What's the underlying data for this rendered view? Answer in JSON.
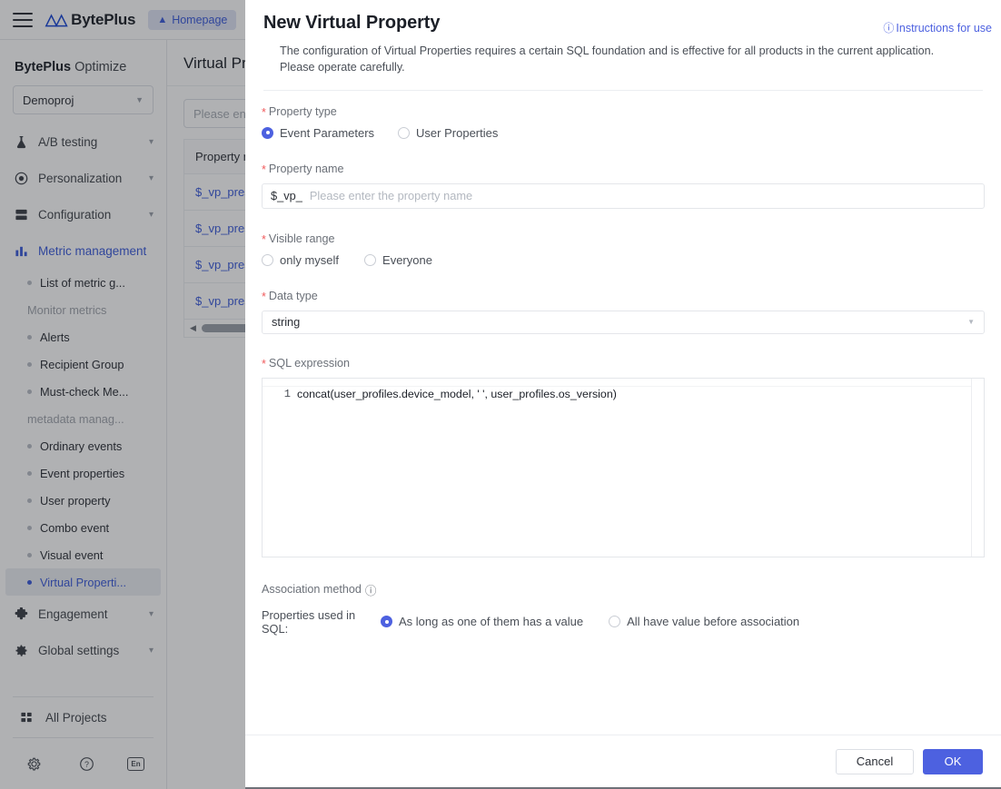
{
  "topbar": {
    "menu_icon": "hamburger-icon",
    "brand_mark": "M",
    "brand_name": "BytePlus",
    "homepage_label": "Homepage",
    "home_icon": "home-icon"
  },
  "sidebar": {
    "title_bold": "BytePlus",
    "title_rest": " Optimize",
    "project": {
      "value": "Demoproj",
      "caret_icon": "chevron-down-icon"
    },
    "groups": [
      {
        "label": "A/B testing",
        "icon": "flask-icon",
        "chevron": "chevron-down-icon",
        "active": false
      },
      {
        "label": "Personalization",
        "icon": "target-icon",
        "chevron": "chevron-down-icon",
        "active": false
      },
      {
        "label": "Configuration",
        "icon": "server-icon",
        "chevron": "chevron-down-icon",
        "active": false
      },
      {
        "label": "Metric management",
        "icon": "bar-chart-icon",
        "chevron": "",
        "active": true
      }
    ],
    "metric_children": [
      {
        "type": "item",
        "label": "List of metric g...",
        "selected": false
      },
      {
        "type": "head",
        "label": "Monitor metrics"
      },
      {
        "type": "item",
        "label": "Alerts",
        "selected": false
      },
      {
        "type": "item",
        "label": "Recipient Group",
        "selected": false
      },
      {
        "type": "item",
        "label": "Must-check Me...",
        "selected": false
      },
      {
        "type": "head",
        "label": "metadata manag..."
      },
      {
        "type": "item",
        "label": "Ordinary events",
        "selected": false
      },
      {
        "type": "item",
        "label": "Event properties",
        "selected": false
      },
      {
        "type": "item",
        "label": "User property",
        "selected": false
      },
      {
        "type": "item",
        "label": "Combo event",
        "selected": false
      },
      {
        "type": "item",
        "label": "Visual event",
        "selected": false
      },
      {
        "type": "item",
        "label": "Virtual Properti...",
        "selected": true
      }
    ],
    "groups_after": [
      {
        "label": "Engagement",
        "icon": "puzzle-icon",
        "chevron": "chevron-down-icon"
      },
      {
        "label": "Global settings",
        "icon": "gear-icon",
        "chevron": "chevron-down-icon"
      }
    ],
    "all_projects": {
      "label": "All Projects",
      "icon": "grid-icon"
    },
    "footer_icons": [
      {
        "name": "settings-gear-icon",
        "glyph": "⚙"
      },
      {
        "name": "help-circle-icon",
        "glyph": "?"
      },
      {
        "name": "language-icon",
        "glyph": "En"
      }
    ]
  },
  "page": {
    "title": "Virtual Properties",
    "search_placeholder": "Please enter the property name",
    "table": {
      "columns": [
        "Property name"
      ],
      "rows": [
        [
          "$_vp_preset_device"
        ],
        [
          "$_vp_preset_region"
        ],
        [
          "$_vp_preset_channel"
        ],
        [
          "$_vp_preset_source"
        ]
      ]
    },
    "scroll_arrow_icon": "chevron-left-icon"
  },
  "modal": {
    "title": "New Virtual Property",
    "instructions_link": "Instructions for use",
    "instructions_icon": "info-circle-icon",
    "description": "The configuration of Virtual Properties requires a certain SQL foundation and is effective for all products in the current application. Please operate carefully.",
    "fields": {
      "property_type": {
        "label": "Property type",
        "required": true,
        "options": [
          {
            "label": "Event Parameters",
            "selected": true
          },
          {
            "label": "User Properties",
            "selected": false
          }
        ]
      },
      "property_name": {
        "label": "Property name",
        "required": true,
        "prefix": "$_vp_",
        "value": "",
        "placeholder": "Please enter the property name"
      },
      "visible_range": {
        "label": "Visible range",
        "required": true,
        "options": [
          {
            "label": "only myself",
            "selected": false
          },
          {
            "label": "Everyone",
            "selected": false
          }
        ]
      },
      "data_type": {
        "label": "Data type",
        "required": true,
        "value": "string",
        "caret_icon": "chevron-down-icon"
      },
      "sql_expression": {
        "label": "SQL expression",
        "required": true,
        "lines": [
          {
            "number": "1",
            "code": "concat(user_profiles.device_model, ' ', user_profiles.os_version)"
          }
        ]
      },
      "association_method": {
        "label": "Association method",
        "info_icon": "info-circle-icon",
        "prefix": "Properties used in SQL:",
        "options": [
          {
            "label": "As long as one of them has a value",
            "selected": true
          },
          {
            "label": "All have value before association",
            "selected": false
          }
        ]
      }
    },
    "footer": {
      "cancel_label": "Cancel",
      "ok_label": "OK"
    }
  },
  "colors": {
    "accent": "#4d61e0",
    "link": "#3b5bdb",
    "required": "#f0585a",
    "brand": "#1a47d6"
  }
}
